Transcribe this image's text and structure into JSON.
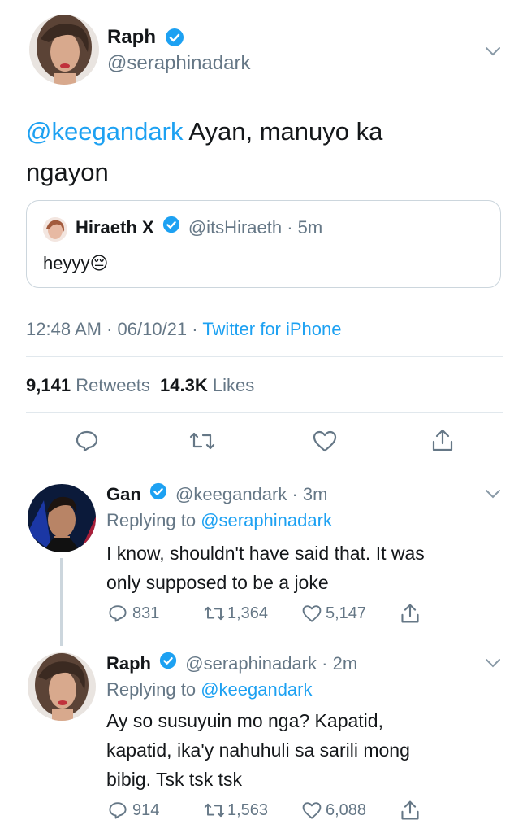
{
  "main_tweet": {
    "name": "Raph",
    "handle": "@seraphinadark",
    "mention": "@keegandark",
    "text_line1": " Ayan, manuyo ka",
    "text_line2": "ngayon",
    "quote": {
      "name": "Hiraeth X",
      "handle": "@itsHiraeth",
      "time": "5m",
      "text": "heyyy😔"
    },
    "time": "12:48 AM",
    "date": "06/10/21",
    "source": "Twitter for iPhone",
    "retweets_count": "9,141",
    "retweets_label": "Retweets",
    "likes_count": "14.3K",
    "likes_label": "Likes"
  },
  "replies": [
    {
      "name": "Gan",
      "handle": "@keegandark",
      "time": "3m",
      "replying_prefix": "Replying to ",
      "replying_to": "@seraphinadark",
      "line1": "I know, shouldn't have said that. It was",
      "line2": "only supposed to be a joke",
      "line3": "",
      "replies": "831",
      "retweets": "1,364",
      "likes": "5,147"
    },
    {
      "name": "Raph",
      "handle": "@seraphinadark",
      "time": "2m",
      "replying_prefix": "Replying to ",
      "replying_to": "@keegandark",
      "line1": "Ay so susuyuin mo nga? Kapatid,",
      "line2": "kapatid, ika'y nahuhuli sa sarili mong",
      "line3": "bibig. Tsk tsk tsk",
      "replies": "914",
      "retweets": "1,563",
      "likes": "6,088"
    }
  ],
  "colors": {
    "accent": "#1da1f2",
    "secondary": "#657786",
    "text": "#14171a",
    "border": "#e1e8ed"
  }
}
